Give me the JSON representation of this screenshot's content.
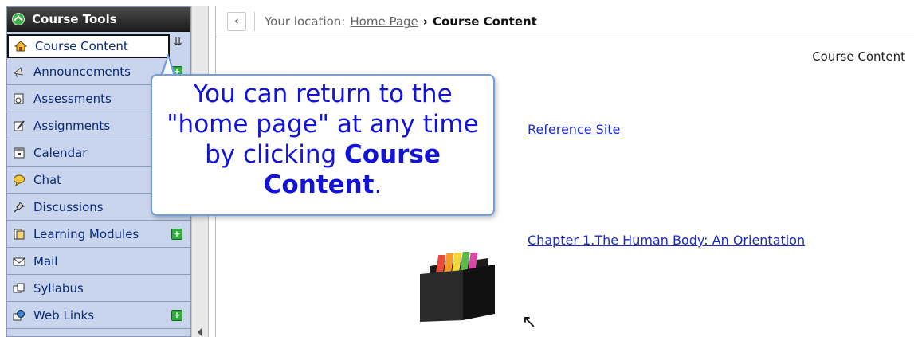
{
  "sidebar": {
    "header": "Course Tools",
    "items": [
      {
        "label": "Course Content",
        "icon": "house-icon",
        "selected": true
      },
      {
        "label": "Announcements",
        "icon": "megaphone-icon",
        "plus": true
      },
      {
        "label": "Assessments",
        "icon": "assessments-icon"
      },
      {
        "label": "Assignments",
        "icon": "assignments-icon"
      },
      {
        "label": "Calendar",
        "icon": "calendar-icon"
      },
      {
        "label": "Chat",
        "icon": "chat-bubble-icon"
      },
      {
        "label": "Discussions",
        "icon": "pushpin-icon"
      },
      {
        "label": "Learning Modules",
        "icon": "learning-modules-icon",
        "plus": true
      },
      {
        "label": "Mail",
        "icon": "mail-icon"
      },
      {
        "label": "Syllabus",
        "icon": "syllabus-icon"
      },
      {
        "label": "Web Links",
        "icon": "globe-icon",
        "plus": true
      }
    ]
  },
  "location": {
    "prefix": "Your location:",
    "home_link": "Home Page",
    "separator": "›",
    "current": "Course Content"
  },
  "page_title": "Course Content",
  "links": {
    "reference": "Reference Site",
    "chapter1": "Chapter 1.The Human Body: An Orientation"
  },
  "callout": {
    "line1": "You can return to the",
    "line2": "\"home page\" at any time",
    "line3_prefix": "by clicking",
    "line3_bold": "Course",
    "line4_bold": "Content",
    "line4_suffix": "."
  },
  "colors": {
    "sidebar_bg": "#c9d5ec",
    "callout_text": "#1212d9",
    "link": "#1c2bc8"
  }
}
